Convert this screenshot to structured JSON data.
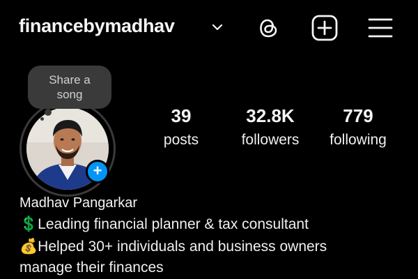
{
  "header": {
    "username": "financebymadhav",
    "icons": [
      "chevron-down-icon",
      "threads-icon",
      "add-post-icon",
      "menu-icon"
    ]
  },
  "note": {
    "text_line1": "Share a",
    "text_line2": "song"
  },
  "avatar": {
    "add_badge": "+"
  },
  "stats": {
    "posts": {
      "value": "39",
      "label": "posts"
    },
    "followers": {
      "value": "32.8K",
      "label": "followers"
    },
    "following": {
      "value": "779",
      "label": "following"
    }
  },
  "profile": {
    "display_name": "Madhav Pangarkar",
    "bio": {
      "line1": "💲Leading financial planner & tax consultant",
      "line2": "💰Helped 30+ individuals and business owners",
      "line3": "manage their finances"
    }
  },
  "colors": {
    "background": "#000000",
    "accent": "#0095f6",
    "bubble": "#3a3a3a"
  }
}
